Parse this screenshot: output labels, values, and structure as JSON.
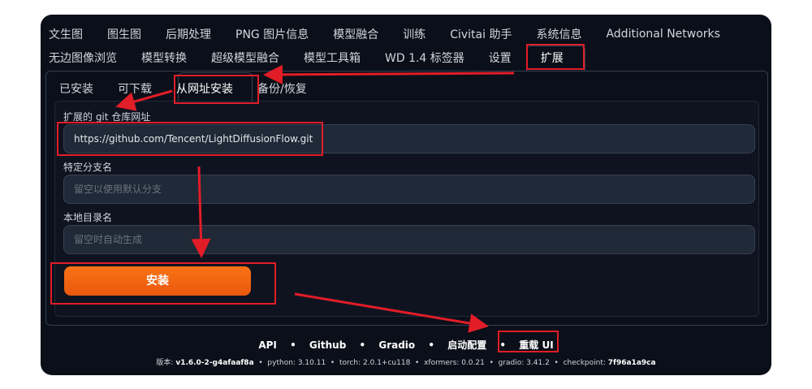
{
  "tabs_row1": [
    "文生图",
    "图生图",
    "后期处理",
    "PNG 图片信息",
    "模型融合",
    "训练",
    "Civitai 助手",
    "系统信息",
    "Additional Networks"
  ],
  "tabs_row2": [
    "无边图像浏览",
    "模型转换",
    "超级模型融合",
    "模型工具箱",
    "WD 1.4 标签器",
    "设置",
    "扩展"
  ],
  "subtabs": [
    "已安装",
    "可下载",
    "从网址安装",
    "备份/恢复"
  ],
  "form": {
    "git_label": "扩展的 git 仓库网址",
    "git_value": "https://github.com/Tencent/LightDiffusionFlow.git",
    "branch_label": "特定分支名",
    "branch_placeholder": "留空以使用默认分支",
    "dir_label": "本地目录名",
    "dir_placeholder": "留空时自动生成",
    "install_label": "安装"
  },
  "footer": {
    "links": [
      "API",
      "Github",
      "Gradio",
      "启动配置",
      "重载 UI"
    ],
    "separator": "•",
    "version": {
      "version_label": "版本: ",
      "version_value": "v1.6.0-2-g4afaaf8a",
      "python_label": "python: ",
      "python_value": "3.10.11",
      "torch_label": "torch: ",
      "torch_value": "2.0.1+cu118",
      "xformers_label": "xformers: ",
      "xformers_value": "0.0.21",
      "gradio_label": "gradio: ",
      "gradio_value": "3.41.2",
      "checkpoint_label": "checkpoint: ",
      "checkpoint_value": "7f96a1a9ca"
    }
  },
  "colors": {
    "accent": "#f97316",
    "highlight": "#e11d27",
    "background": "#0b0f19"
  }
}
